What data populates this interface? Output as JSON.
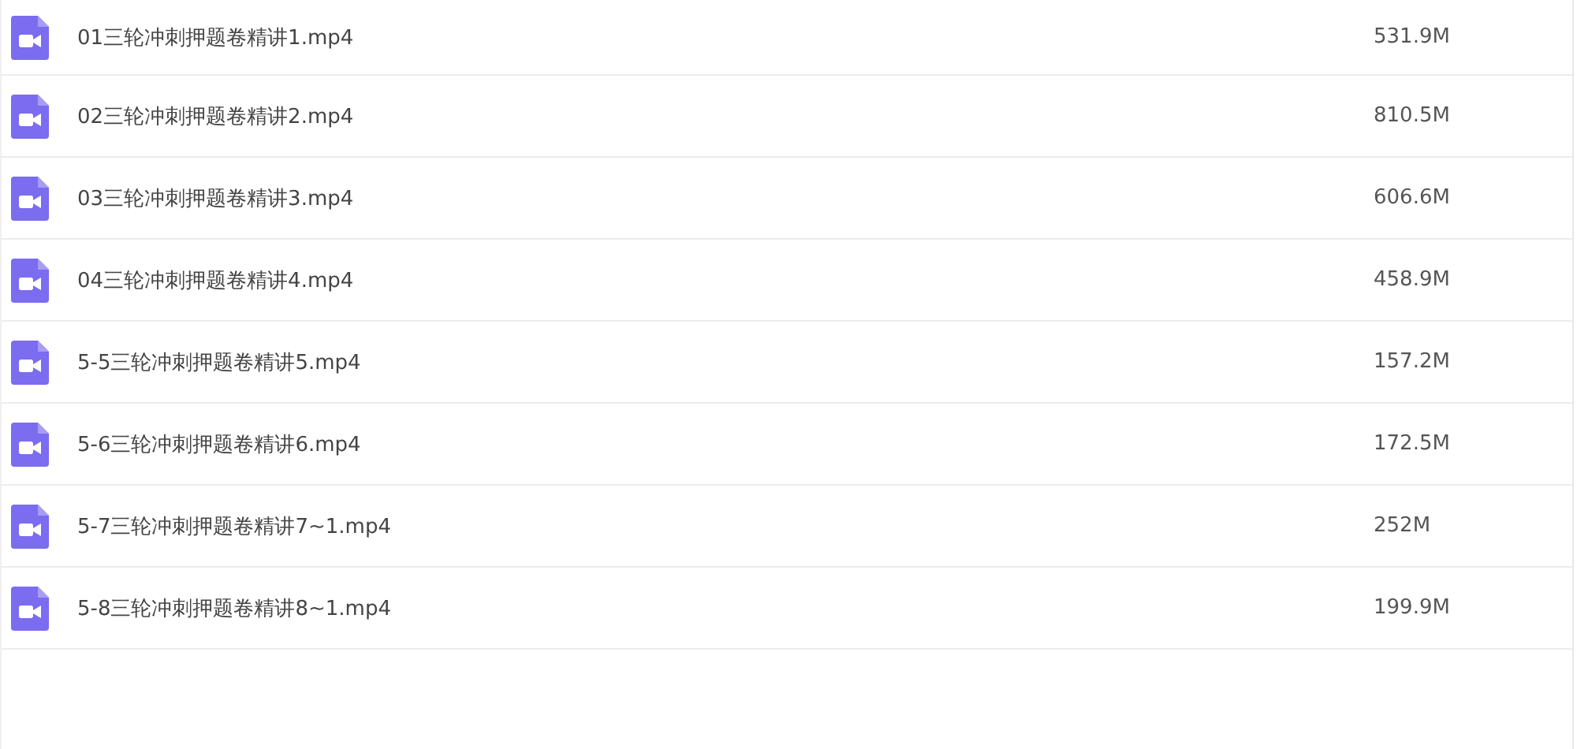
{
  "files": [
    {
      "kind": "video",
      "name": "01三轮冲刺押题卷精讲1.mp4",
      "size": "531.9M"
    },
    {
      "kind": "video",
      "name": "02三轮冲刺押题卷精讲2.mp4",
      "size": "810.5M"
    },
    {
      "kind": "video",
      "name": "03三轮冲刺押题卷精讲3.mp4",
      "size": "606.6M"
    },
    {
      "kind": "video",
      "name": "04三轮冲刺押题卷精讲4.mp4",
      "size": "458.9M"
    },
    {
      "kind": "video",
      "name": "5-5三轮冲刺押题卷精讲5.mp4",
      "size": "157.2M"
    },
    {
      "kind": "video",
      "name": "5-6三轮冲刺押题卷精讲6.mp4",
      "size": "172.5M"
    },
    {
      "kind": "video",
      "name": "5-7三轮冲刺押题卷精讲7~1.mp4",
      "size": "252M"
    },
    {
      "kind": "video",
      "name": "5-8三轮冲刺押题卷精讲8~1.mp4",
      "size": "199.9M"
    }
  ]
}
